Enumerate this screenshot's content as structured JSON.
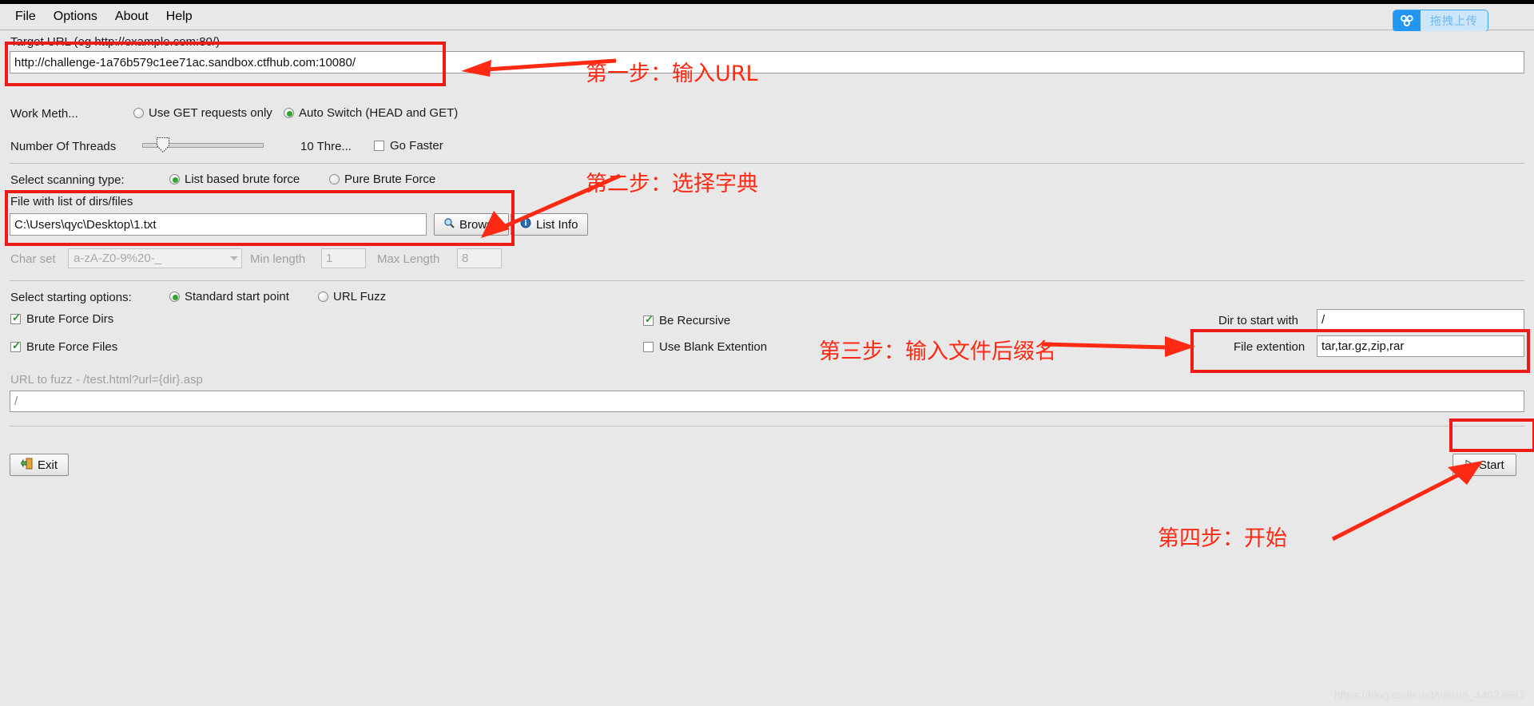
{
  "window": {
    "menu": [
      "File",
      "Options",
      "About",
      "Help"
    ]
  },
  "upload_widget": {
    "label": "拖拽上传",
    "icon": "baidu-netdisk-icon",
    "icon_bg": "#2196f3",
    "label_bg": "#cce7fb",
    "label_color": "#6fb8ee"
  },
  "target": {
    "legend": "Target URL (eg http://example.com:80/)",
    "url": "http://challenge-1a76b579c1ee71ac.sandbox.ctfhub.com:10080/"
  },
  "work_method": {
    "label": "Work Meth...",
    "option_get": "Use GET requests only",
    "option_auto": "Auto Switch (HEAD and GET)",
    "selected": "auto"
  },
  "threads": {
    "label": "Number Of Threads",
    "value_text": "10 Thre...",
    "go_faster_label": "Go Faster",
    "go_faster_checked": false,
    "slider_percent": 12
  },
  "scan_type": {
    "label": "Select scanning type:",
    "option_list": "List based brute force",
    "option_pure": "Pure Brute Force",
    "selected": "list"
  },
  "dir_file": {
    "legend": "File with list of dirs/files",
    "path": "C:\\Users\\qyc\\Desktop\\1.txt",
    "browse_label": "Browse",
    "browse_icon": "magnifier-icon",
    "list_info_label": "List Info",
    "list_info_icon": "info-icon"
  },
  "charset_row": {
    "charset_label": "Char set",
    "charset_value": "a-zA-Z0-9%20-_",
    "min_label": "Min length",
    "min_value": "1",
    "max_label": "Max Length",
    "max_value": "8",
    "disabled": true
  },
  "starting_options": {
    "label": "Select starting options:",
    "option_standard": "Standard start point",
    "option_fuzz": "URL Fuzz",
    "selected": "standard"
  },
  "checkboxes": {
    "brute_force_dirs": {
      "label": "Brute Force Dirs",
      "checked": true
    },
    "brute_force_files": {
      "label": "Brute Force Files",
      "checked": true
    },
    "be_recursive": {
      "label": "Be Recursive",
      "checked": true
    },
    "use_blank_extention": {
      "label": "Use Blank Extention",
      "checked": false
    }
  },
  "right_fields": {
    "dir_start_label": "Dir to start with",
    "dir_start_value": "/",
    "file_ext_label": "File extention",
    "file_ext_value": "tar,tar.gz,zip,rar"
  },
  "fuzz": {
    "label": "URL to fuzz - /test.html?url={dir}.asp",
    "value": "/"
  },
  "buttons": {
    "exit_label": "Exit",
    "exit_icon": "exit-door-icon",
    "start_label": "Start",
    "start_icon": "play-triangle-icon"
  },
  "annotations": {
    "step1": "第一步：输入URL",
    "step2": "第二步：选择字典",
    "step3": "第三步：输入文件后缀名",
    "step4": "第四步：开始",
    "color": "#ff2a13"
  },
  "watermark": "https://blog.csdn.net/weixin_44023693"
}
